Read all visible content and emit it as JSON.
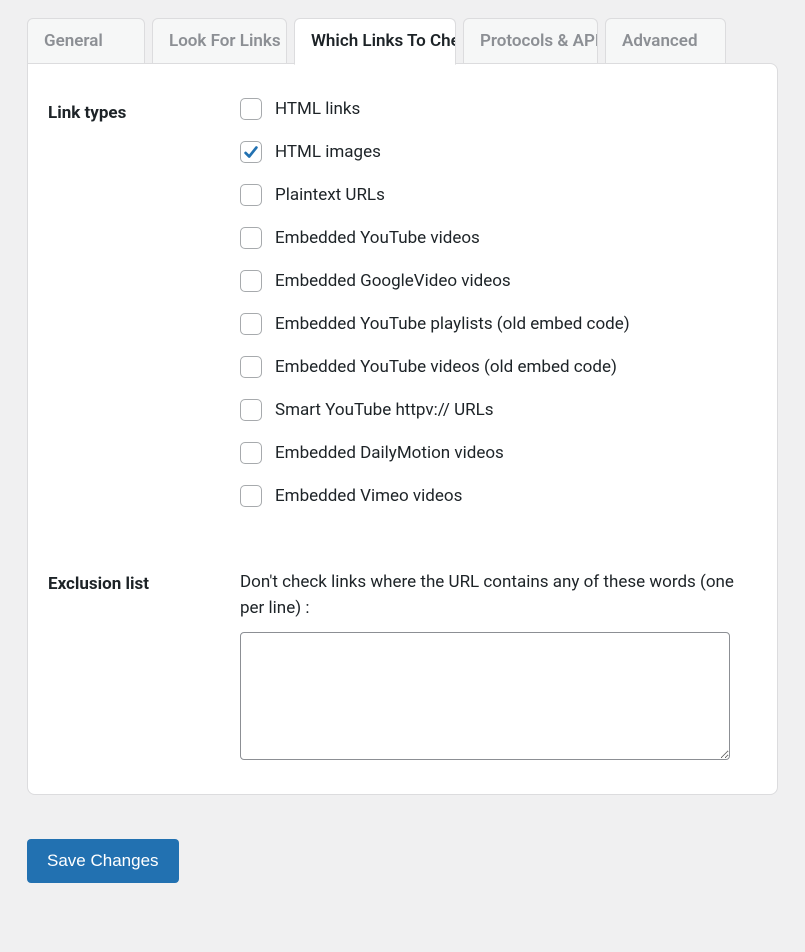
{
  "tabs": [
    {
      "label": "General"
    },
    {
      "label": "Look For Links In"
    },
    {
      "label": "Which Links To Check"
    },
    {
      "label": "Protocols & APIs"
    },
    {
      "label": "Advanced"
    }
  ],
  "active_tab_index": 2,
  "sections": {
    "link_types": {
      "label": "Link types",
      "options": [
        {
          "label": "HTML links",
          "checked": false
        },
        {
          "label": "HTML images",
          "checked": true
        },
        {
          "label": "Plaintext URLs",
          "checked": false
        },
        {
          "label": "Embedded YouTube videos",
          "checked": false
        },
        {
          "label": "Embedded GoogleVideo videos",
          "checked": false
        },
        {
          "label": "Embedded YouTube playlists (old embed code)",
          "checked": false
        },
        {
          "label": "Embedded YouTube videos (old embed code)",
          "checked": false
        },
        {
          "label": "Smart YouTube httpv:// URLs",
          "checked": false
        },
        {
          "label": "Embedded DailyMotion videos",
          "checked": false
        },
        {
          "label": "Embedded Vimeo videos",
          "checked": false
        }
      ]
    },
    "exclusion_list": {
      "label": "Exclusion list",
      "description": "Don't check links where the URL contains any of these words (one per line) :",
      "value": ""
    }
  },
  "save_button_label": "Save Changes"
}
